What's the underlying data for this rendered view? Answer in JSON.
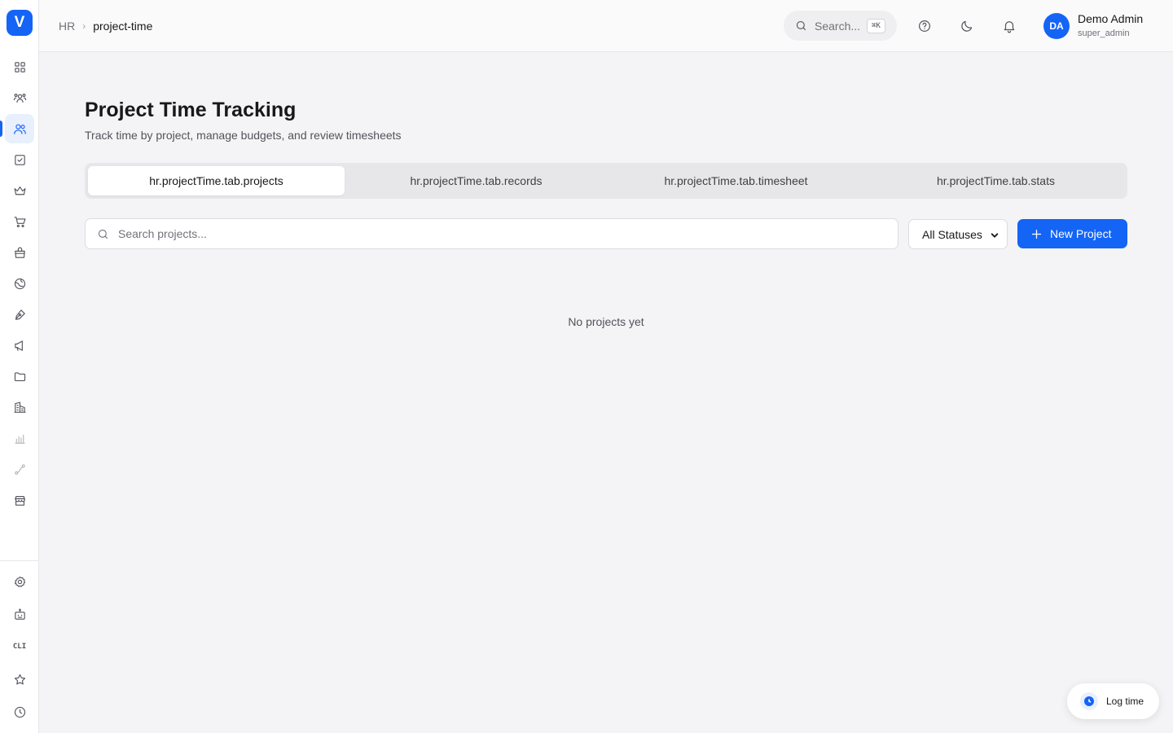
{
  "app": {
    "logo_letter": "V",
    "brand_color": "#1464f6"
  },
  "sidebar": {
    "items": [
      {
        "name": "dashboard-icon"
      },
      {
        "name": "team-icon"
      },
      {
        "name": "users-icon",
        "active": true
      },
      {
        "name": "task-checkbox-icon"
      },
      {
        "name": "crown-icon"
      },
      {
        "name": "cart-icon"
      },
      {
        "name": "shopping-bag-icon"
      },
      {
        "name": "globe-icon"
      },
      {
        "name": "pen-icon"
      },
      {
        "name": "megaphone-icon"
      },
      {
        "name": "folder-icon"
      },
      {
        "name": "building-icon"
      },
      {
        "name": "chart-icon"
      },
      {
        "name": "route-icon"
      },
      {
        "name": "store-icon"
      }
    ],
    "bottom_items": [
      {
        "name": "settings-icon"
      },
      {
        "name": "robot-icon"
      },
      {
        "name": "cli-icon",
        "label": "CLI"
      },
      {
        "name": "star-icon"
      },
      {
        "name": "clock-icon"
      }
    ]
  },
  "header": {
    "breadcrumb": {
      "parent": "HR",
      "current": "project-time"
    },
    "search": {
      "placeholder": "Search...",
      "shortcut": "⌘K"
    },
    "icons": [
      "help-icon",
      "moon-icon",
      "bell-icon"
    ],
    "user": {
      "initials": "DA",
      "name": "Demo Admin",
      "role": "super_admin"
    }
  },
  "main": {
    "title": "Project Time Tracking",
    "subtitle": "Track time by project, manage budgets, and review timesheets",
    "tabs": [
      {
        "label": "hr.projectTime.tab.projects",
        "active": true
      },
      {
        "label": "hr.projectTime.tab.records"
      },
      {
        "label": "hr.projectTime.tab.timesheet"
      },
      {
        "label": "hr.projectTime.tab.stats"
      }
    ],
    "search": {
      "placeholder": "Search projects...",
      "value": ""
    },
    "status_filter": {
      "selected": "All Statuses"
    },
    "new_button_label": "New Project",
    "empty_message": "No projects yet"
  },
  "floating": {
    "log_time_label": "Log time"
  }
}
